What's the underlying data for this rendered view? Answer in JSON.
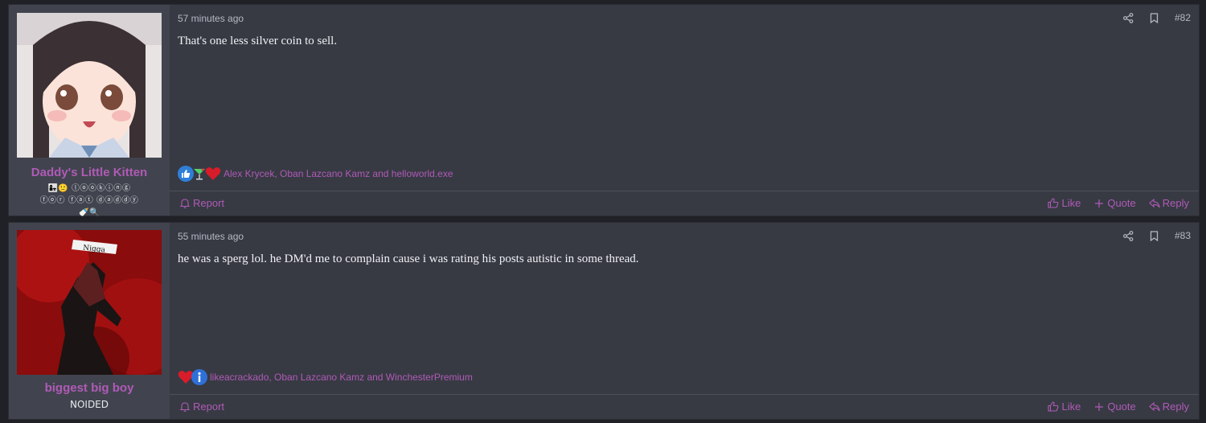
{
  "posts": [
    {
      "username": "Daddy's Little Kitten",
      "user_title": "👩‍👧🙁 ⓛⓞⓞⓚⓘⓝⓖ ⓕⓞⓡ ⓕⓐⓣ ⓓⓐⓓⓓⓨ 🍼🔍",
      "time": "57 minutes ago",
      "post_number": "#82",
      "content": "That's one less silver coin to sell.",
      "reactions_text": "Alex Krycek, Oban Lazcano Kamz and helloworld.exe",
      "reaction_icons": [
        "like-icon",
        "cocktail-icon",
        "heart-icon"
      ],
      "report_label": "Report",
      "like_label": "Like",
      "quote_label": "Quote",
      "reply_label": "Reply"
    },
    {
      "username": "biggest big boy",
      "user_title": "NOIDED",
      "time": "55 minutes ago",
      "post_number": "#83",
      "content": "he was a sperg lol. he DM'd me to complain cause i was rating his posts autistic in some thread.",
      "reactions_text": "likeacrackado, Oban Lazcano Kamz and WinchesterPremium",
      "reaction_icons": [
        "heart-icon",
        "info-icon"
      ],
      "report_label": "Report",
      "like_label": "Like",
      "quote_label": "Quote",
      "reply_label": "Reply"
    }
  ],
  "colors": {
    "accent": "#b05ab7",
    "post_bg": "#373a43",
    "user_bg": "#41444e"
  }
}
